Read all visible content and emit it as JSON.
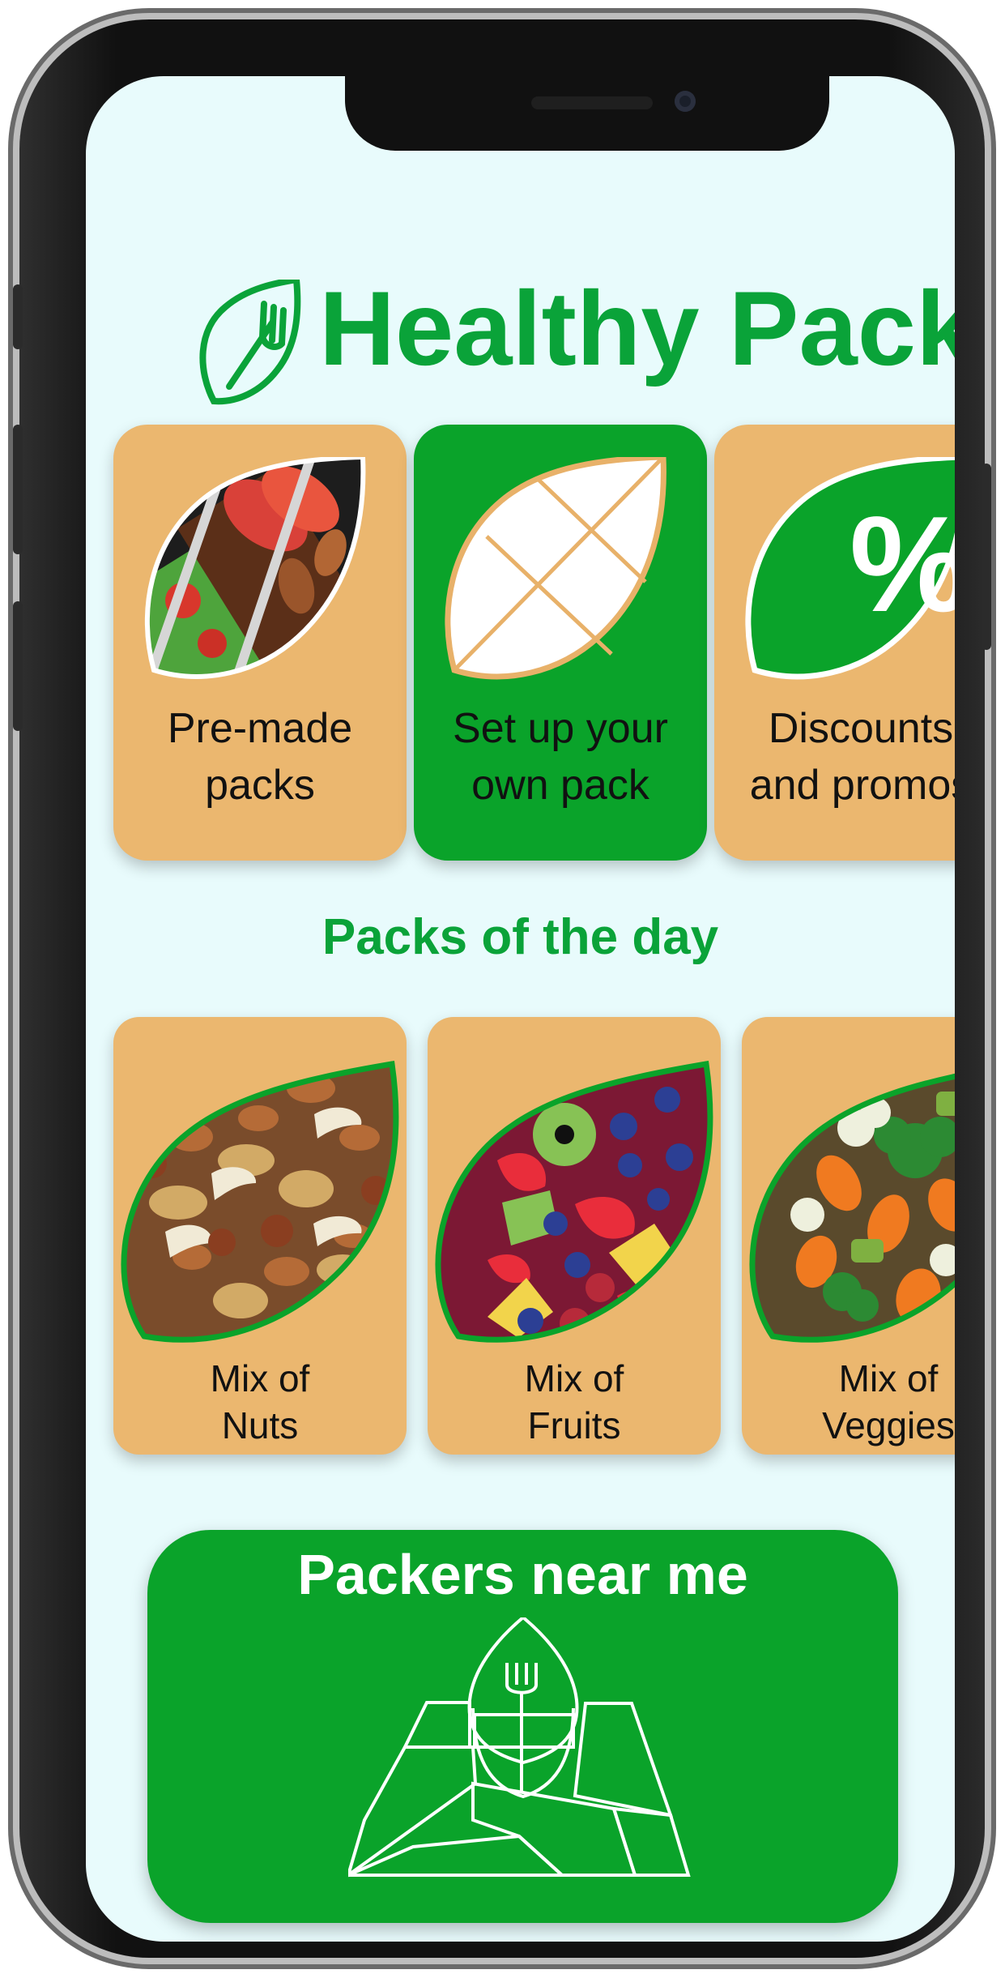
{
  "app": {
    "title": "Healthy Pack"
  },
  "quick_actions": [
    {
      "label": "Pre-made\npacks",
      "icon": "salad-leaf-icon",
      "background": "#ebb76f"
    },
    {
      "label": "Set up your\nown pack",
      "icon": "custom-pack-leaf-icon",
      "background": "#0aa32a"
    },
    {
      "label": "Discounts\nand promos",
      "icon": "percent-leaf-icon",
      "background": "#ebb76f"
    }
  ],
  "packs_section": {
    "title": "Packs of the day",
    "items": [
      {
        "label": "Mix of\nNuts",
        "icon": "nuts-mix-icon"
      },
      {
        "label": "Mix of\nFruits",
        "icon": "fruit-mix-icon"
      },
      {
        "label": "Mix of\nVeggies",
        "icon": "veggie-mix-icon"
      }
    ]
  },
  "nearby": {
    "title": "Packers near me",
    "icon": "map-location-fork-icon"
  },
  "colors": {
    "brand_green": "#0aa339",
    "card_tan": "#ebb76f",
    "screen_bg": "#e8fbfc"
  }
}
